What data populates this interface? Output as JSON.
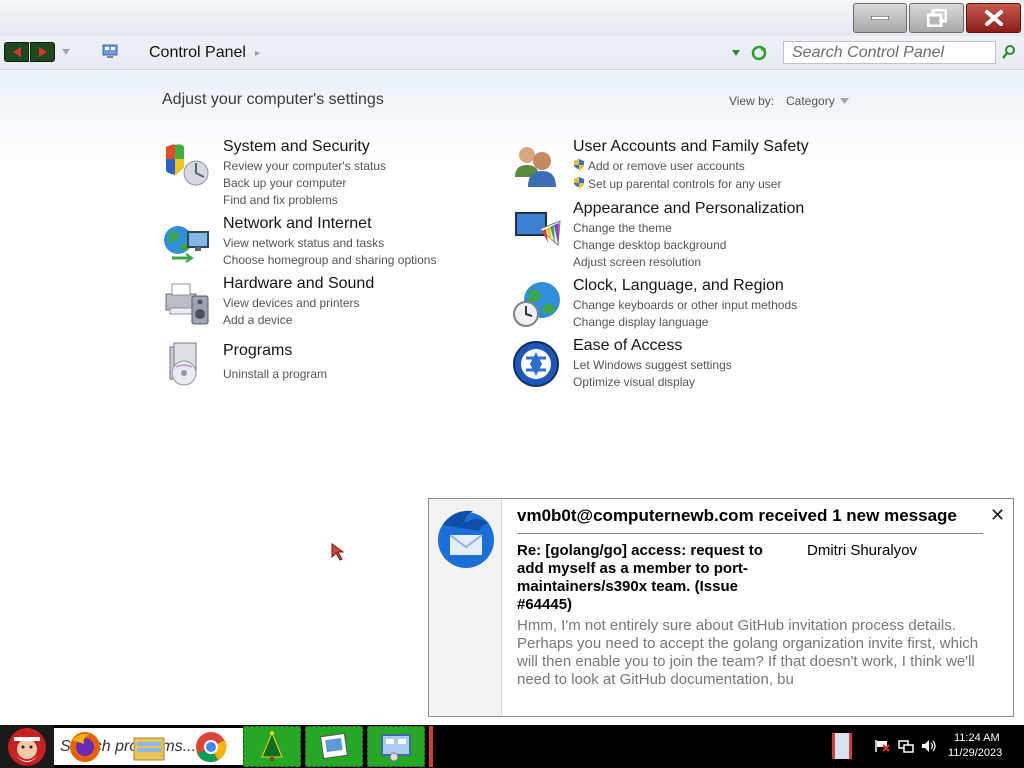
{
  "window": {
    "buttons": {
      "minimize": "minimize",
      "maximize": "restore",
      "close": "close"
    }
  },
  "address_bar": {
    "breadcrumb": "Control Panel",
    "search_placeholder": "Search Control Panel"
  },
  "content": {
    "title": "Adjust your computer's settings",
    "view_by_label": "View by:",
    "view_by_value": "Category",
    "categories": [
      {
        "title": "System and Security",
        "icon": "shield-icon",
        "links": [
          "Review your computer's status",
          "Back up your computer",
          "Find and fix problems"
        ]
      },
      {
        "title": "Network and Internet",
        "icon": "network-globe-icon",
        "links": [
          "View network status and tasks",
          "Choose homegroup and sharing options"
        ]
      },
      {
        "title": "Hardware and Sound",
        "icon": "printer-speaker-icon",
        "links": [
          "View devices and printers",
          "Add a device"
        ]
      },
      {
        "title": "Programs",
        "icon": "programs-disc-icon",
        "links": [
          "Uninstall a program"
        ]
      },
      {
        "title": "User Accounts and Family Safety",
        "icon": "users-icon",
        "links": [
          "Add or remove user accounts",
          "Set up parental controls for any user"
        ]
      },
      {
        "title": "Appearance and Personalization",
        "icon": "monitor-palette-icon",
        "links": [
          "Change the theme",
          "Change desktop background",
          "Adjust screen resolution"
        ]
      },
      {
        "title": "Clock, Language, and Region",
        "icon": "clock-globe-icon",
        "links": [
          "Change keyboards or other input methods",
          "Change display language"
        ]
      },
      {
        "title": "Ease of Access",
        "icon": "ease-of-access-icon",
        "links": [
          "Let Windows suggest settings",
          "Optimize visual display"
        ]
      }
    ]
  },
  "notification": {
    "heading": "vm0b0t@computernewb.com received 1 new message",
    "subject": "Re: [golang/go] access: request to add myself as a member to port-maintainers/s390x team. (Issue #64445)",
    "sender": "Dmitri Shuralyov",
    "body": "Hmm, I'm not entirely sure about GitHub invitation process details. Perhaps you need to accept the golang organization invite first, which will then enable you to join the team? If that doesn't work, I think we'll need to look at GitHub documentation, bu",
    "close_glyph": "✕"
  },
  "taskbar": {
    "search_text": "Search programs...",
    "clock_time": "11:24 AM",
    "clock_date": "11/29/2023"
  },
  "colors": {
    "taskbar": "#000000",
    "taskbar_app_highlight": "#26a826",
    "close_button": "#b5362a"
  }
}
